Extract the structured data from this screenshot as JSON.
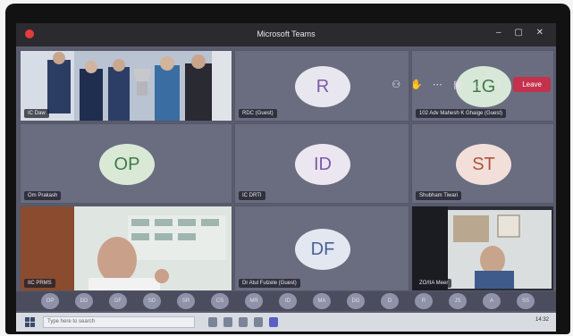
{
  "window": {
    "title": "Microsoft Teams"
  },
  "toolbar": {
    "leave_label": "Leave"
  },
  "tiles": [
    {
      "kind": "video",
      "name": "IC Daw",
      "scene": "trophy"
    },
    {
      "kind": "avatar",
      "initials": "R",
      "name": "RDC (Guest)",
      "bg": "#e8e6ee",
      "fg": "#7b5aa8"
    },
    {
      "kind": "avatar",
      "initials": "1G",
      "name": "102 Adv Mahesh K Ghaige (Guest)",
      "bg": "#d8e8d8",
      "fg": "#3f7a4a"
    },
    {
      "kind": "avatar",
      "initials": "OP",
      "name": "Om Prakash",
      "bg": "#d9e9d6",
      "fg": "#3f7a4a"
    },
    {
      "kind": "avatar",
      "initials": "ID",
      "name": "IC DRTI",
      "bg": "#ece6f1",
      "fg": "#7b5aa8"
    },
    {
      "kind": "avatar",
      "initials": "ST",
      "name": "Shubham Tiwari",
      "bg": "#f2dfd9",
      "fg": "#b0533f"
    },
    {
      "kind": "video",
      "name": "IIC PRMS",
      "scene": "office"
    },
    {
      "kind": "avatar",
      "initials": "DF",
      "name": "Dr Atul Fulzele (Guest)",
      "bg": "#e2e7f0",
      "fg": "#4a5f9a"
    },
    {
      "kind": "video",
      "name": "ZO/IIA Meer",
      "scene": "shelf"
    }
  ],
  "participants_strip": [
    "OP",
    "DD",
    "DF",
    "SD",
    "SR",
    "CS",
    "MR",
    "ID",
    "MA",
    "DG",
    "D",
    "R",
    "JS",
    "A",
    "SS"
  ],
  "taskbar": {
    "search_placeholder": "Type here to search",
    "clock": "14:32"
  }
}
